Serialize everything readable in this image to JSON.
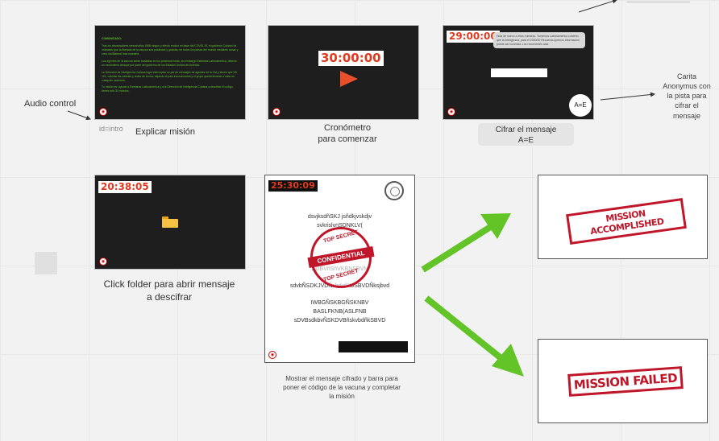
{
  "labels": {
    "audio_control": "Audio control",
    "id_intro": "id=intro",
    "explain_mission": "Explicar misión",
    "stopwatch": "Cronómetro\npara comenzar",
    "cipher_message": "Cifrar el mensaje\nA=E",
    "anonymous_card": "Carita\nAnonymus con\nla pista para\ncifrar el\nmensaje",
    "click_folder": "Click folder para  abrir mensaje\na descifrar",
    "show_message": "Mostrar el mensaje cifrado y barra para\nponer el código de la vacuna y completar\nla misión"
  },
  "cards": {
    "intro": {
      "title": "COMUNICADO:",
      "p1": "Tras los devastadores meses/años 1988 ningun y efecto erotico en base del COVID-19, el gobierno Cubano ha ordenado que la liberado de la vacuna sea publicado y gratuita, en todos los paises del mundo mediante aunar y crea, multilateral mas maestria.",
      "p2": "Los agentes de la vacuna serán trasladas en los próximos horas, sin embargo Estelaras Latinoamerica, detecto un movimiento atraque por parte del gobierno de los Estados Unidos de América.",
      "p3": "La Dirección de Inteligencia Cubana logró interceptar un par de mensajes de agentes de la CIA y tienen que VD 101, calcular las cádulas y redes de la mia, dejando el país inconcluso/da y el grupo queda llevarse a cabo en cualquier momento.",
      "p4": "Tu misión es: ayudar a Estelaras Latinoamerica y a la Dirección de Inteligencia Cubana a descifrar el código, tienes solo 30 minutos."
    },
    "stopwatch_timer": "30:00:00",
    "cipher_timer": "29:00:00",
    "cipher_bubble": "Hola de nuevo a ellos nuestras. Tomemos Latinoamerica cubierto, que la inteligencia, para el 2030/30 Recuerda quemos informacion puede ser lucreada. Los recorrientes alas",
    "anon_key": "A=E",
    "folder_timer": "20:38:05",
    "message_timer": "25:30:09",
    "cipher_lines": [
      "dsvjksdñSKJ jsñdkjvskdjv",
      "svkrislvnSDNKLV(",
      "SDBVñSñVKBNSBVN",
      "sdvbÑSDKJVDÑsbdvñKJSBVDÑksjbvd",
      "",
      "IWBGÑSKBGÑSKNBV",
      "BASLFKNB(ASLFNB",
      "sDVBsdkbvÑSKDVBñskvbdñkSBVD"
    ],
    "stamp_top": "TOP SECRET",
    "stamp_mid": "CONFIDENTIAL",
    "stamp_bottom": "TOP SECRET",
    "accomplished": "MISSION ACCOMPLISHED",
    "failed": "MISSION FAILED"
  },
  "colors": {
    "card_dark": "#1e1e1e",
    "timer_red": "#e03a1e",
    "green_text": "#5ec02e",
    "arrow_green": "#62c426",
    "stamp_red": "#c0162a"
  }
}
